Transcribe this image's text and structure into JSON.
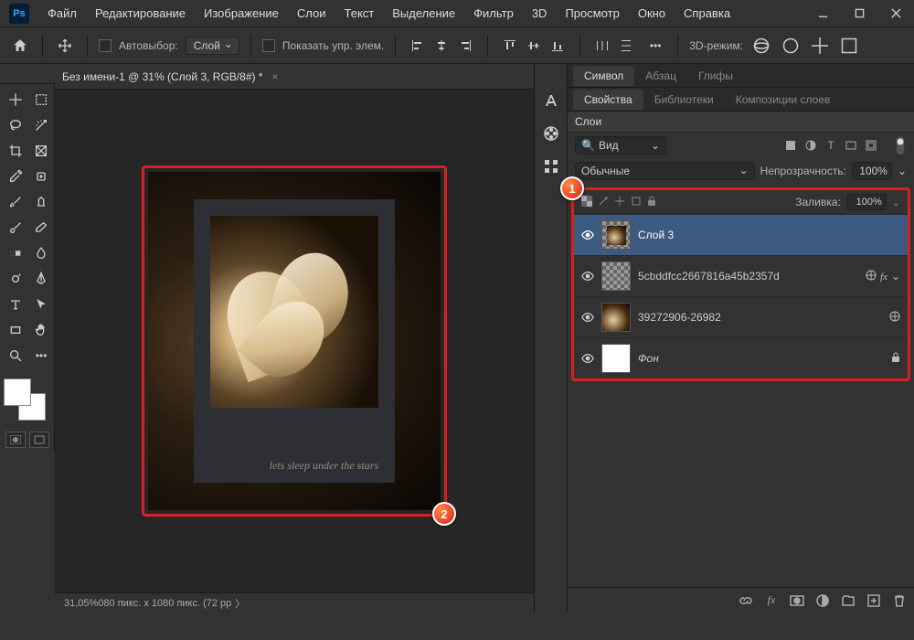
{
  "menu": {
    "file": "Файл",
    "edit": "Редактирование",
    "image": "Изображение",
    "layer": "Слои",
    "type": "Текст",
    "select": "Выделение",
    "filter": "Фильтр",
    "threed": "3D",
    "view": "Просмотр",
    "window": "Окно",
    "help": "Справка"
  },
  "options": {
    "auto_select": "Автовыбор:",
    "auto_select_target": "Слой",
    "show_transform": "Показать упр. элем.",
    "mode_3d": "3D-режим:"
  },
  "document": {
    "tab_title": "Без имени-1 @ 31% (Слой 3, RGB/8#) *",
    "zoom_label": "31,05%",
    "dim_label": "080 пикс. x 1080 пикс. (72 pp"
  },
  "polaroid_caption": "lets sleep\nunder the\nstars",
  "panels": {
    "symbol_tab": "Символ",
    "paragraph_tab": "Абзац",
    "glyphs_tab": "Глифы",
    "properties_tab": "Свойства",
    "libraries_tab": "Библиотеки",
    "layercomps_tab": "Композиции слоев",
    "layers_title": "Слои",
    "search_label": "Вид",
    "blend_mode": "Обычные",
    "opacity_label": "Непрозрачность:",
    "opacity_value": "100%",
    "fill_label": "Заливка:",
    "fill_value": "100%"
  },
  "layers": [
    {
      "name": "Слой 3",
      "selected": true,
      "thumb": "flower-checker",
      "fx": false,
      "smart": false,
      "lock": false,
      "italic": false
    },
    {
      "name": "5cbddfcc2667816a45b2357d",
      "selected": false,
      "thumb": "checker",
      "fx": true,
      "smart": true,
      "lock": false,
      "italic": false
    },
    {
      "name": "39272906-26982",
      "selected": false,
      "thumb": "flower",
      "fx": false,
      "smart": true,
      "lock": false,
      "italic": false
    },
    {
      "name": "Фон",
      "selected": false,
      "thumb": "white",
      "fx": false,
      "smart": false,
      "lock": true,
      "italic": true
    }
  ],
  "markers": {
    "one": "1",
    "two": "2"
  },
  "search_icon": "🔍"
}
